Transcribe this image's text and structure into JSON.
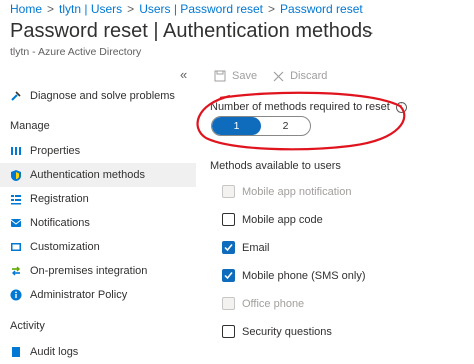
{
  "breadcrumb": [
    "Home",
    "tlytn | Users",
    "Users | Password reset",
    "Password reset"
  ],
  "page": {
    "title": "Password reset | Authentication methods",
    "more": "···",
    "subtitle": "tlytn - Azure Active Directory"
  },
  "sidebar": {
    "collapse": "«",
    "diagnose": "Diagnose and solve problems",
    "manage_heading": "Manage",
    "items": [
      {
        "label": "Properties",
        "icon": "properties-icon"
      },
      {
        "label": "Authentication methods",
        "icon": "shield-icon",
        "active": true
      },
      {
        "label": "Registration",
        "icon": "registration-icon"
      },
      {
        "label": "Notifications",
        "icon": "bell-icon"
      },
      {
        "label": "Customization",
        "icon": "customization-icon"
      },
      {
        "label": "On-premises integration",
        "icon": "sync-icon"
      },
      {
        "label": "Administrator Policy",
        "icon": "info-icon"
      }
    ],
    "activity_heading": "Activity",
    "audit_logs": "Audit logs"
  },
  "toolbar": {
    "save": "Save",
    "discard": "Discard"
  },
  "methods_required": {
    "label": "Number of methods required to reset",
    "options": [
      "1",
      "2"
    ],
    "selected": "1"
  },
  "methods_available": {
    "label": "Methods available to users",
    "items": [
      {
        "label": "Mobile app notification",
        "checked": false,
        "disabled": true
      },
      {
        "label": "Mobile app code",
        "checked": false,
        "disabled": false
      },
      {
        "label": "Email",
        "checked": true,
        "disabled": false
      },
      {
        "label": "Mobile phone (SMS only)",
        "checked": true,
        "disabled": false
      },
      {
        "label": "Office phone",
        "checked": false,
        "disabled": true
      },
      {
        "label": "Security questions",
        "checked": false,
        "disabled": false
      }
    ]
  },
  "colors": {
    "accent": "#0f6cbd",
    "link": "#0078d4",
    "highlight": "#e0141e"
  }
}
